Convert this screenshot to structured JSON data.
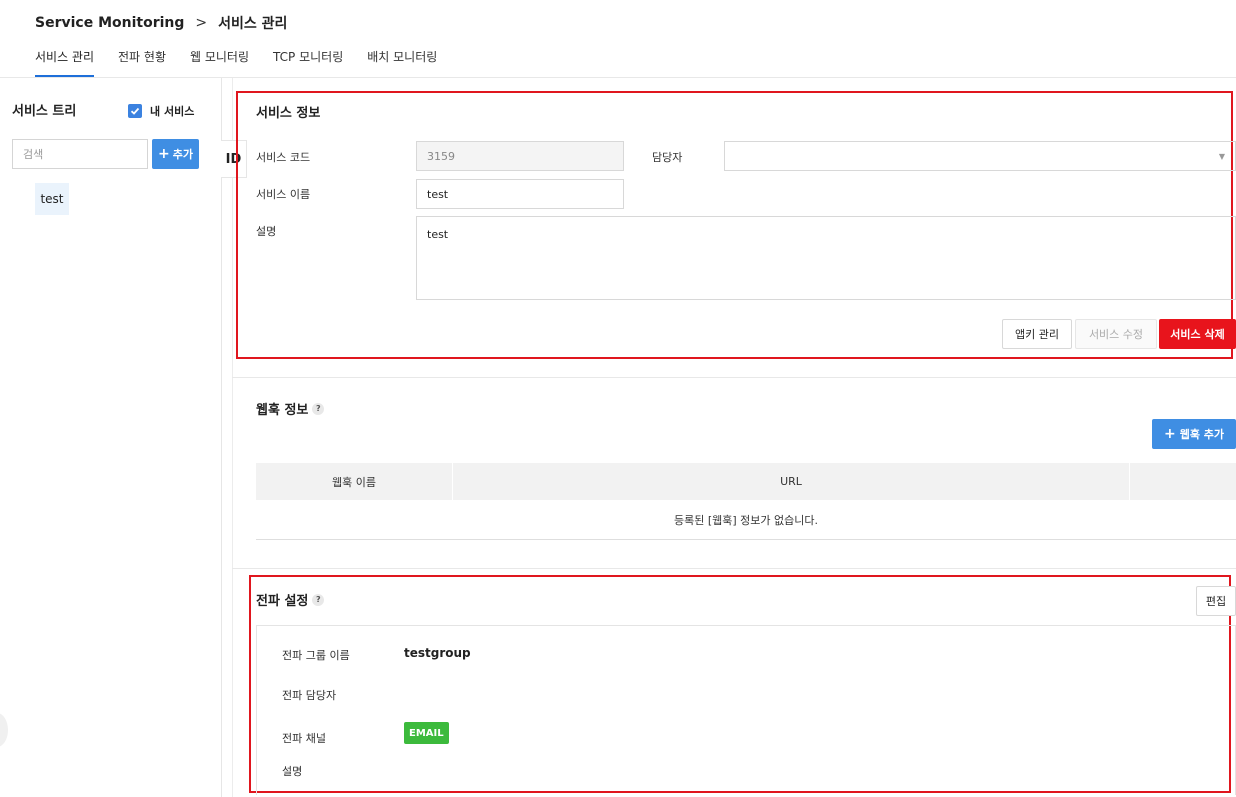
{
  "breadcrumb": {
    "root": "Service Monitoring",
    "separator": ">",
    "current": "서비스 관리"
  },
  "tabs": [
    {
      "label": "서비스 관리",
      "active": true
    },
    {
      "label": "전파 현황",
      "active": false
    },
    {
      "label": "웹 모니터링",
      "active": false
    },
    {
      "label": "TCP 모니터링",
      "active": false
    },
    {
      "label": "배치 모니터링",
      "active": false
    }
  ],
  "sidebar": {
    "title": "서비스 트리",
    "my_service_label": "내 서비스",
    "my_service_checked": true,
    "search_placeholder": "검색",
    "add_label": "추가",
    "items": [
      {
        "label": "test"
      }
    ],
    "id_tab_label": "ID"
  },
  "service_info": {
    "title": "서비스 정보",
    "code_label": "서비스 코드",
    "code_value": "3159",
    "owner_label": "담당자",
    "owner_value": "",
    "name_label": "서비스 이름",
    "name_value": "test",
    "desc_label": "설명",
    "desc_value": "test",
    "buttons": {
      "appkey": "앱키 관리",
      "edit": "서비스 수정",
      "delete": "서비스 삭제"
    }
  },
  "webhook": {
    "title": "웹훅 정보",
    "add_label": "웹훅 추가",
    "columns": [
      "웹훅 이름",
      "URL",
      ""
    ],
    "empty_text": "등록된 [웹훅] 정보가 없습니다."
  },
  "notification": {
    "title": "전파 설정",
    "edit_label": "편집",
    "group_label": "전파 그룹 이름",
    "group_value": "testgroup",
    "manager_label": "전파 담당자",
    "manager_value": "",
    "channel_label": "전파 채널",
    "channel_badge": "EMAIL",
    "desc_label": "설명",
    "desc_value": ""
  },
  "colors": {
    "accent": "#3f8ee3",
    "danger": "#e8141c",
    "highlight_outline": "#e0161e",
    "badge_green": "#3cba3c"
  }
}
